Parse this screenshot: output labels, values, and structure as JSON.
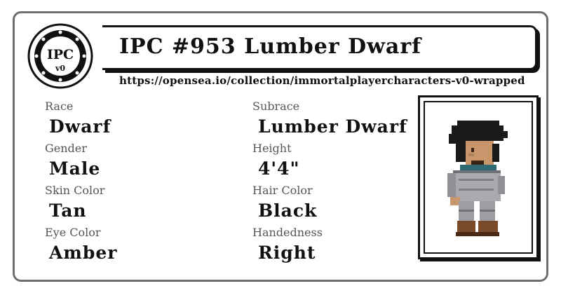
{
  "card": {
    "logo_text": "IPC",
    "logo_sub": "v0",
    "title": "IPC #953 Lumber Dwarf",
    "url": "https://opensea.io/collection/immortalplayercharacters-v0-wrapped"
  },
  "attributes": {
    "race_label": "Race",
    "race_value": "Dwarf",
    "subrace_label": "Subrace",
    "subrace_value": "Lumber Dwarf",
    "gender_label": "Gender",
    "gender_value": "Male",
    "height_label": "Height",
    "height_value": "4'4\"",
    "skin_label": "Skin Color",
    "skin_value": "Tan",
    "hair_label": "Hair Color",
    "hair_value": "Black",
    "eye_label": "Eye Color",
    "eye_value": "Amber",
    "hand_label": "Handedness",
    "hand_value": "Right"
  },
  "colors": {
    "border": "#6e6e6e",
    "ink": "#111111",
    "hair": "#1a1a1a",
    "skin": "#c9956a",
    "armor": "#a8aab0",
    "boots": "#7a4a2a"
  }
}
